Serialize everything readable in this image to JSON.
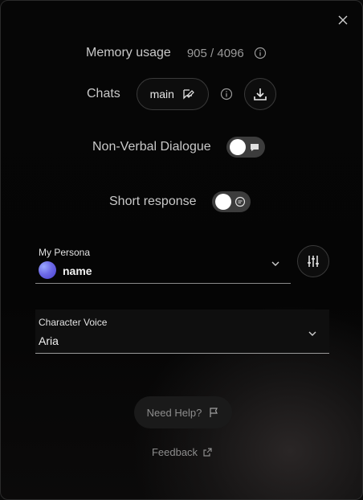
{
  "memory": {
    "label": "Memory usage",
    "value": "905 / 4096"
  },
  "chats": {
    "label": "Chats",
    "current": "main"
  },
  "toggles": {
    "non_verbal": {
      "label": "Non-Verbal Dialogue",
      "on": false
    },
    "short_response": {
      "label": "Short response",
      "on": false
    }
  },
  "persona": {
    "label": "My Persona",
    "name": "name"
  },
  "voice": {
    "label": "Character Voice",
    "value": "Aria"
  },
  "help": {
    "label": "Need Help?"
  },
  "feedback": {
    "label": "Feedback"
  },
  "icons": {
    "close": "close-icon",
    "info": "info-icon",
    "chat_edit": "chat-edit-icon",
    "download": "download-icon",
    "dialogue": "speech-bubble-icon",
    "response": "chat-bubble-icon",
    "dropdown": "chevron-down-icon",
    "settings": "sliders-icon",
    "flag": "flag-icon",
    "external": "external-link-icon"
  }
}
